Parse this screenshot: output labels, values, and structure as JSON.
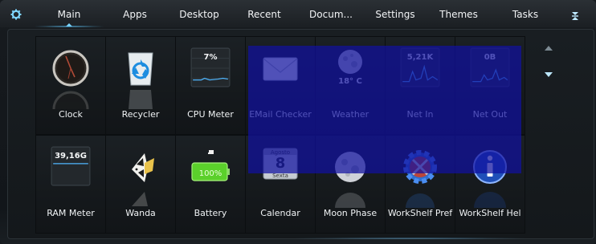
{
  "tabs": [
    {
      "label": "Main",
      "active": true
    },
    {
      "label": "Apps",
      "active": false
    },
    {
      "label": "Desktop",
      "active": false
    },
    {
      "label": "Recent",
      "active": false
    },
    {
      "label": "Docum...",
      "active": false
    },
    {
      "label": "Settings",
      "active": false
    },
    {
      "label": "Themes",
      "active": false
    },
    {
      "label": "Tasks",
      "active": false
    }
  ],
  "icons": [
    {
      "label": "Clock",
      "icon": "clock-icon"
    },
    {
      "label": "Recycler",
      "icon": "recycle-bin-icon"
    },
    {
      "label": "CPU Meter",
      "icon": "cpu-meter-icon",
      "value": "7%"
    },
    {
      "label": "EMail Checker",
      "icon": "envelope-icon"
    },
    {
      "label": "Weather",
      "icon": "moon-weather-icon",
      "value": "18° C"
    },
    {
      "label": "Net In",
      "icon": "net-in-meter-icon",
      "value": "5,21K"
    },
    {
      "label": "Net Out",
      "icon": "net-out-meter-icon",
      "value": "0B"
    },
    {
      "label": "RAM Meter",
      "icon": "ram-meter-icon",
      "value": "39,16G"
    },
    {
      "label": "Wanda",
      "icon": "fish-icon"
    },
    {
      "label": "Battery",
      "icon": "battery-icon",
      "value": "100%"
    },
    {
      "label": "Calendar",
      "icon": "calendar-icon",
      "month": "Agosto",
      "day": "8",
      "weekday": "Sexta"
    },
    {
      "label": "Moon Phase",
      "icon": "moon-phase-icon"
    },
    {
      "label": "WorkShelf Pref",
      "icon": "gear-tools-icon"
    },
    {
      "label": "WorkShelf Hel",
      "icon": "info-icon"
    }
  ],
  "colors": {
    "accent": "#5fc8ff",
    "selection": "#1010a0",
    "background": "#161a1e"
  }
}
